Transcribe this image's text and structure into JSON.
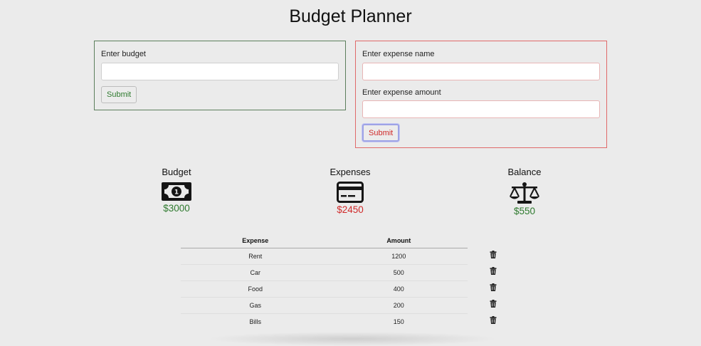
{
  "title": "Budget Planner",
  "budget_form": {
    "label": "Enter budget",
    "value": "",
    "submit_label": "Submit"
  },
  "expense_form": {
    "name_label": "Enter expense name",
    "name_value": "",
    "amount_label": "Enter expense amount",
    "amount_value": "",
    "submit_label": "Submit"
  },
  "summary": {
    "budget": {
      "label": "Budget",
      "value": "$3000",
      "icon": "money-bill-icon"
    },
    "expenses": {
      "label": "Expenses",
      "value": "$2450",
      "icon": "credit-card-icon"
    },
    "balance": {
      "label": "Balance",
      "value": "$550",
      "icon": "scale-balance-icon"
    }
  },
  "table": {
    "headers": [
      "Expense",
      "Amount"
    ],
    "rows": [
      {
        "expense": "Rent",
        "amount": "1200"
      },
      {
        "expense": "Car",
        "amount": "500"
      },
      {
        "expense": "Food",
        "amount": "400"
      },
      {
        "expense": "Gas",
        "amount": "200"
      },
      {
        "expense": "Bills",
        "amount": "150"
      }
    ],
    "delete_icon": "trash-icon"
  },
  "colors": {
    "positive": "#2e7a2e",
    "negative": "#d02a2a",
    "budget_border": "#5c7f5c",
    "expense_border": "#e06a6a"
  }
}
